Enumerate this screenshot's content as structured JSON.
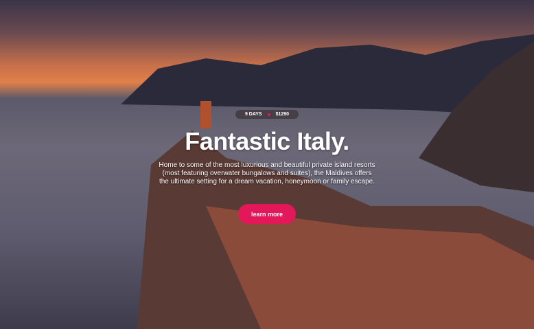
{
  "hero": {
    "days": "9 DAYS",
    "price": "$1290",
    "title": "Fantastic Italy.",
    "description": "Home to some of the most luxurious and beautiful private island resorts (most featuring overwater bungalows and suites), the Maldives offers the ultimate setting for a dream vacation, honeymoon or family escape.",
    "cta": "learn more"
  },
  "colors": {
    "accent": "#e3185a"
  }
}
